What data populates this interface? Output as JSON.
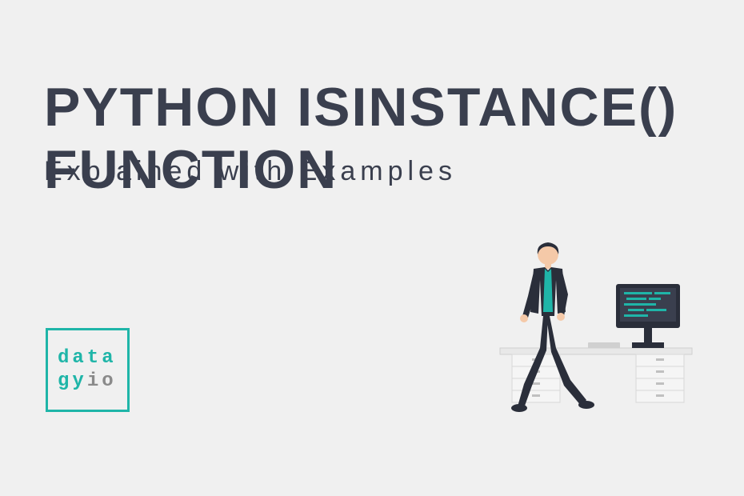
{
  "title": "PYTHON ISINSTANCE() FUNCTION",
  "subtitle": "Explained with Examples",
  "logo": {
    "line1": "data",
    "line2_gy": "gy",
    "line2_io": "io"
  },
  "colors": {
    "background": "#f0f0f0",
    "text": "#3a3f4e",
    "accent": "#1fb5a8",
    "muted": "#8a8a8a"
  }
}
